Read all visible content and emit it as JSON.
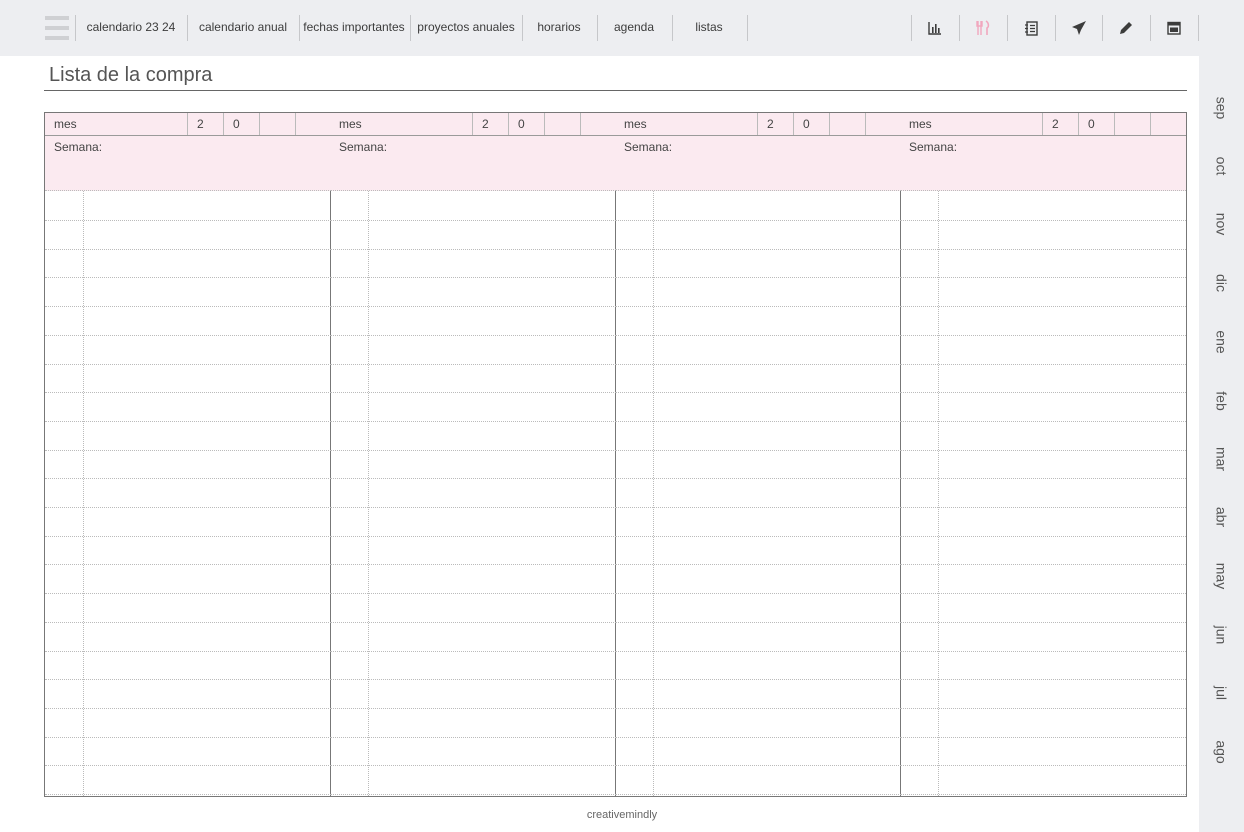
{
  "topbar": {
    "tabs": [
      {
        "label": "calendario 23 24"
      },
      {
        "label": "calendario anual"
      },
      {
        "label": "fechas importantes"
      },
      {
        "label": "proyectos anuales"
      },
      {
        "label": "horarios"
      },
      {
        "label": "agenda"
      },
      {
        "label": "listas"
      }
    ],
    "icons": [
      {
        "name": "bar-chart-icon",
        "color": "#3c3c3c"
      },
      {
        "name": "cutlery-icon",
        "color": "#f1a7be"
      },
      {
        "name": "notebook-icon",
        "color": "#3c3c3c"
      },
      {
        "name": "airplane-icon",
        "color": "#3c3c3c"
      },
      {
        "name": "pencil-icon",
        "color": "#3c3c3c"
      },
      {
        "name": "calendar-icon",
        "color": "#3c3c3c"
      }
    ]
  },
  "page": {
    "title": "Lista de la compra",
    "footer": "creativemindly"
  },
  "week_columns": [
    {
      "mes_label": "mes",
      "year_digits": [
        "2",
        "0",
        "",
        ""
      ],
      "semana_label": "Semana:"
    },
    {
      "mes_label": "mes",
      "year_digits": [
        "2",
        "0",
        "",
        ""
      ],
      "semana_label": "Semana:"
    },
    {
      "mes_label": "mes",
      "year_digits": [
        "2",
        "0",
        "",
        ""
      ],
      "semana_label": "Semana:"
    },
    {
      "mes_label": "mes",
      "year_digits": [
        "2",
        "0",
        "",
        ""
      ],
      "semana_label": "Semana:"
    }
  ],
  "months": [
    "sep",
    "oct",
    "nov",
    "dic",
    "ene",
    "feb",
    "mar",
    "abr",
    "may",
    "jun",
    "jul",
    "ago"
  ],
  "colors": {
    "header_pink": "#fbeaf0",
    "accent_pink": "#f1a7be",
    "bar_gray": "#edeef1"
  }
}
